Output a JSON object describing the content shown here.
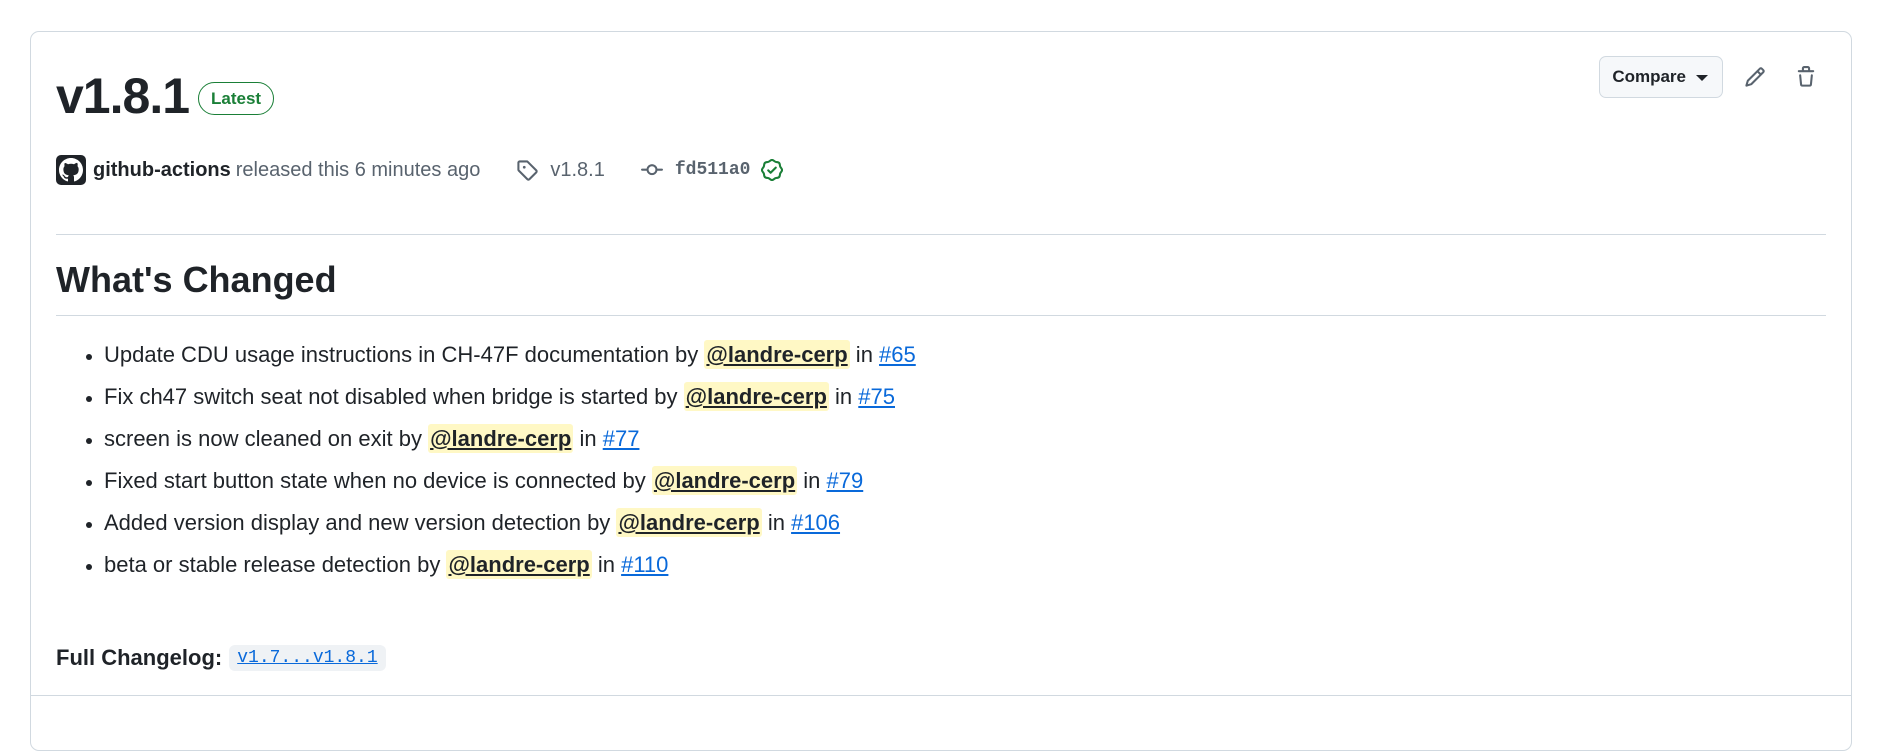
{
  "release": {
    "title": "v1.8.1",
    "badge": "Latest",
    "author": "github-actions",
    "released_text": "released this 6 minutes ago",
    "tag": "v1.8.1",
    "commit": "fd511a0"
  },
  "actions": {
    "compare_label": "Compare"
  },
  "section": {
    "title": "What's Changed"
  },
  "changes": [
    {
      "text": "Update CDU usage instructions in CH-47F documentation by ",
      "user": "@landre-cerp",
      "in": " in ",
      "pr": "#65"
    },
    {
      "text": "Fix ch47 switch seat not disabled when bridge is started by ",
      "user": "@landre-cerp",
      "in": " in ",
      "pr": "#75"
    },
    {
      "text": "screen is now cleaned on exit by ",
      "user": "@landre-cerp",
      "in": " in ",
      "pr": "#77"
    },
    {
      "text": "Fixed start button state when no device is connected by ",
      "user": "@landre-cerp",
      "in": " in ",
      "pr": "#79"
    },
    {
      "text": "Added version display and new version detection by ",
      "user": "@landre-cerp",
      "in": " in ",
      "pr": "#106"
    },
    {
      "text": "beta or stable release detection by ",
      "user": "@landre-cerp",
      "in": " in ",
      "pr": "#110"
    }
  ],
  "changelog": {
    "label": "Full Changelog",
    "sep": ": ",
    "link": "v1.7...v1.8.1"
  },
  "icons": {
    "avatar": "github-mark-icon",
    "tag": "tag-icon",
    "commit": "git-commit-icon",
    "verified": "verified-check-icon",
    "edit": "pencil-icon",
    "delete": "trash-icon"
  },
  "colors": {
    "badge_green": "#1a7f37",
    "link_blue": "#0969da",
    "mention_bg": "#fff8c5",
    "border": "#d1d9e0"
  }
}
